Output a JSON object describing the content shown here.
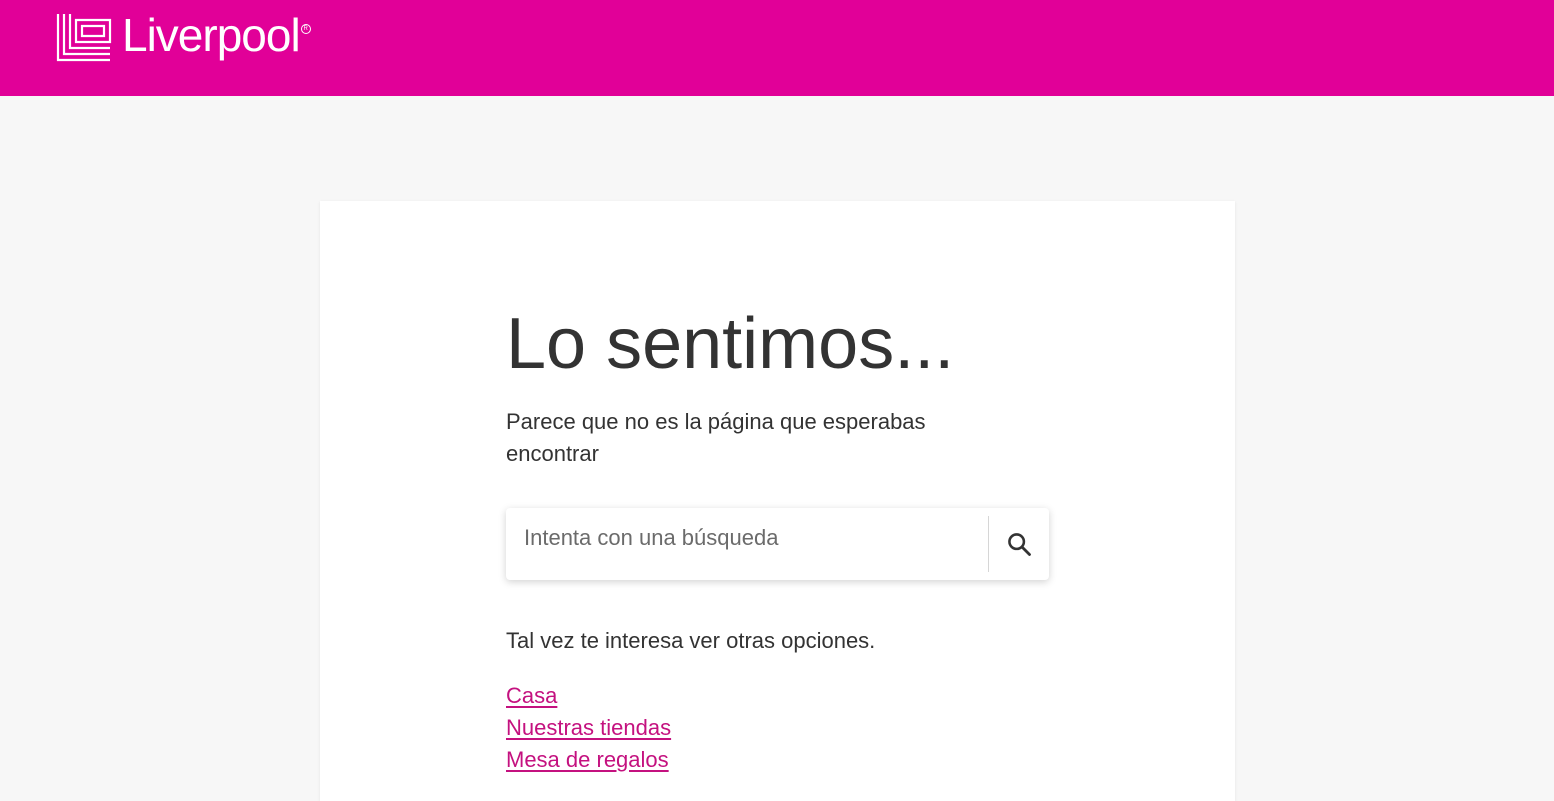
{
  "header": {
    "brand_name": "Liverpool",
    "background_color": "#e10098",
    "logo_icon": "liverpool-logo-icon"
  },
  "main": {
    "title": "Lo sentimos...",
    "subtitle": "Parece que no es la página que esperabas encontrar",
    "search": {
      "placeholder": "Intenta con una búsqueda",
      "value": "",
      "button_icon": "search-icon"
    },
    "options_text": "Tal vez te interesa ver otras opciones.",
    "links": [
      {
        "label": "Casa"
      },
      {
        "label": "Nuestras tiendas"
      },
      {
        "label": "Mesa de regalos"
      }
    ],
    "link_color": "#c4117f"
  }
}
